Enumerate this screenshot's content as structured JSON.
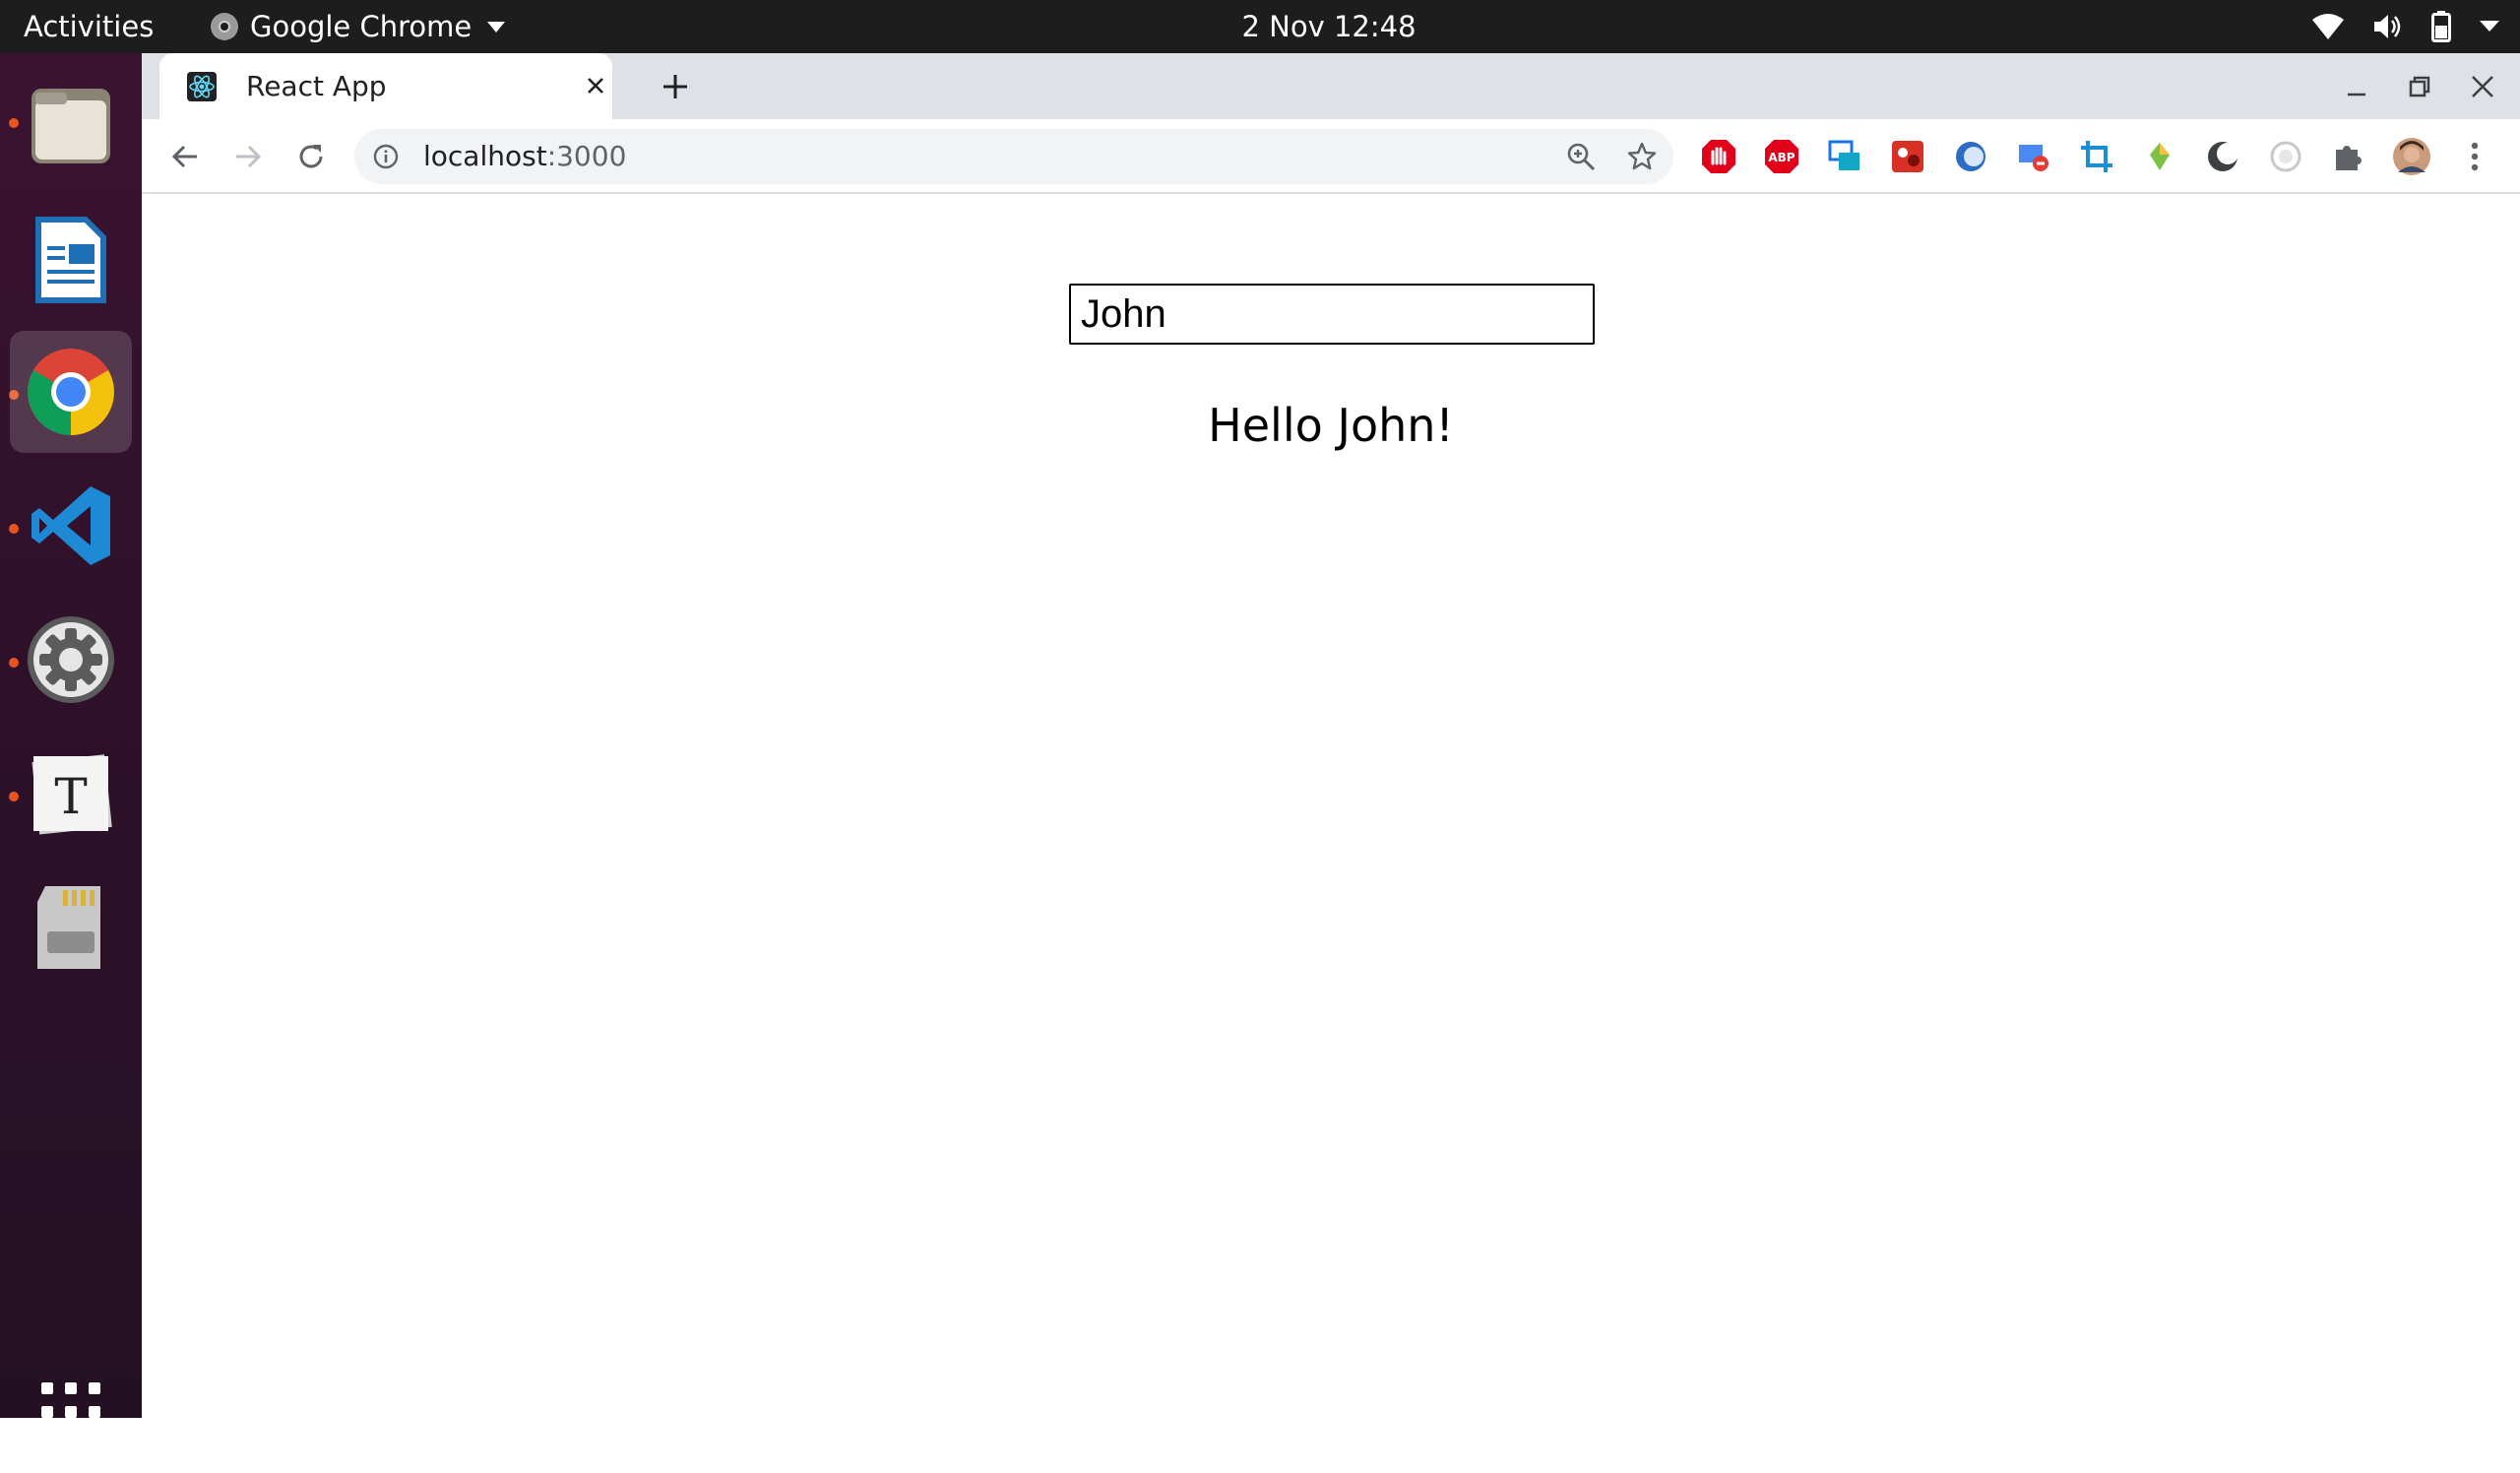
{
  "topbar": {
    "activities": "Activities",
    "app_name": "Google Chrome",
    "datetime": "2 Nov  12:48"
  },
  "dock": {
    "items": [
      "Files",
      "LibreOffice Writer",
      "Google Chrome",
      "Visual Studio Code",
      "Settings",
      "Typora",
      "Software"
    ],
    "show_apps": "Show Applications"
  },
  "browser": {
    "tab_title": "React App",
    "url_host": "localhost",
    "url_port": ":3000",
    "extensions": [
      "adblock-icon",
      "abp-icon",
      "screen-icon",
      "red-ext-icon",
      "blue-ring-icon",
      "mail-block-icon",
      "crop-icon",
      "gem-icon",
      "moon-icon",
      "circle-icon",
      "puzzle-icon"
    ]
  },
  "page": {
    "name_value": "John",
    "greeting": "Hello John!"
  },
  "colors": {
    "accent": "#e95420",
    "tabstrip": "#dee1e6",
    "topbar": "#1d1d1d"
  }
}
